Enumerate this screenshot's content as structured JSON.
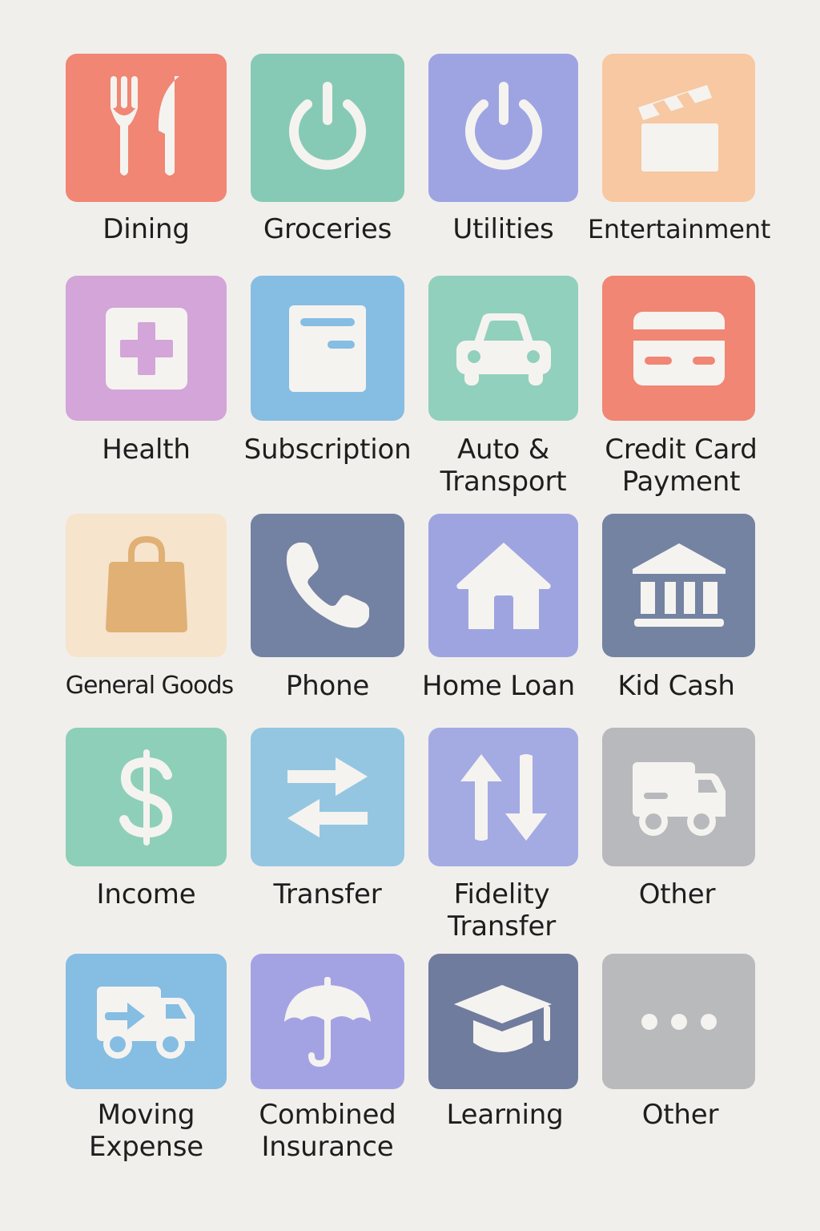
{
  "categories": [
    {
      "label": "Dining",
      "icon": "fork-knife-icon",
      "color": "#f08673"
    },
    {
      "label": "Groceries",
      "icon": "power-icon",
      "color": "#86cab5"
    },
    {
      "label": "Utilities",
      "icon": "power-icon",
      "color": "#9ea4e2"
    },
    {
      "label": "Entertainment",
      "icon": "clapperboard-icon",
      "color": "#f7c8a1"
    },
    {
      "label": "Health",
      "icon": "medical-cross-icon",
      "color": "#d3a5d8"
    },
    {
      "label": "Subscription",
      "icon": "document-icon",
      "color": "#86bde2"
    },
    {
      "label": "Auto &\nTransport",
      "icon": "car-icon",
      "color": "#91d0bc"
    },
    {
      "label": "Credit Card\nPayment",
      "icon": "credit-card-icon",
      "color": "#f08673"
    },
    {
      "label": "General Goods",
      "icon": "shopping-bag-icon",
      "color": "#f6e4cc"
    },
    {
      "label": "Phone",
      "icon": "phone-icon",
      "color": "#7382a3"
    },
    {
      "label": "Home Loan",
      "icon": "house-icon",
      "color": "#9ea4e0"
    },
    {
      "label": "Kid Cash",
      "icon": "bank-icon",
      "color": "#7483a2"
    },
    {
      "label": "Income",
      "icon": "dollar-icon",
      "color": "#8ecfb9"
    },
    {
      "label": "Transfer",
      "icon": "swap-arrows-icon",
      "color": "#94c6e2"
    },
    {
      "label": "Fidelity\nTransfer",
      "icon": "up-down-arrows-icon",
      "color": "#a4aae2"
    },
    {
      "label": "Other",
      "icon": "delivery-truck-icon",
      "color": "#b8b9bd"
    },
    {
      "label": "Moving\nExpense",
      "icon": "moving-truck-icon",
      "color": "#86bde2"
    },
    {
      "label": "Combined\nInsurance",
      "icon": "umbrella-icon",
      "color": "#a3a3e4"
    },
    {
      "label": "Learning",
      "icon": "graduation-cap-icon",
      "color": "#707c9e"
    },
    {
      "label": "Other",
      "icon": "more-dots-icon",
      "color": "#b9babc"
    }
  ]
}
